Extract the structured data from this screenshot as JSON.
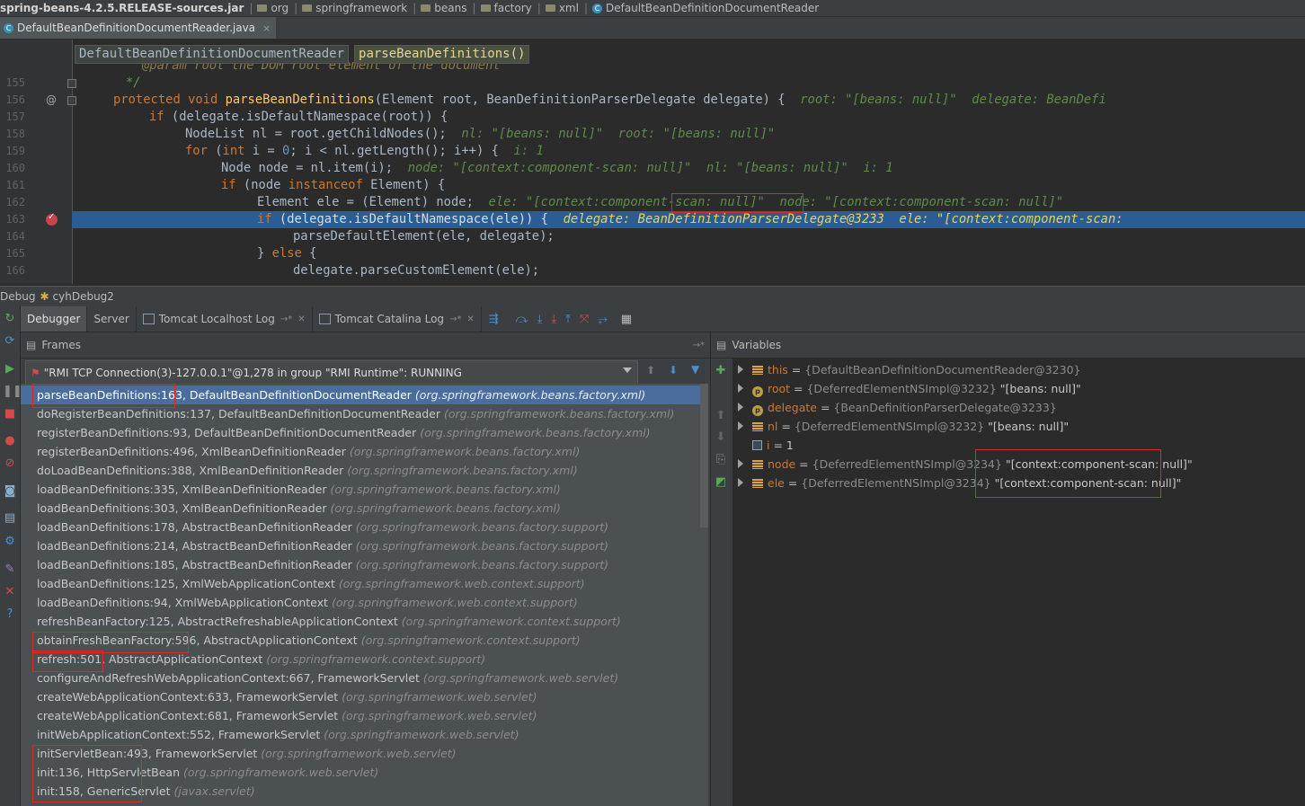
{
  "breadcrumb": [
    {
      "label": "spring-beans-4.2.5.RELEASE-sources.jar",
      "icon": "jar-icon"
    },
    {
      "label": "org",
      "icon": "folder-icon"
    },
    {
      "label": "springframework",
      "icon": "folder-icon"
    },
    {
      "label": "beans",
      "icon": "folder-icon"
    },
    {
      "label": "factory",
      "icon": "folder-icon"
    },
    {
      "label": "xml",
      "icon": "folder-icon"
    },
    {
      "label": "DefaultBeanDefinitionDocumentReader",
      "icon": "class-icon"
    }
  ],
  "file_tab": {
    "label": "DefaultBeanDefinitionDocumentReader.java",
    "close": "×"
  },
  "editor": {
    "header_class": "DefaultBeanDefinitionDocumentReader",
    "header_method": "parseBeanDefinitions()",
    "top_partial": "@param root the DOM root element of the document",
    "lines": [
      {
        "n": "155",
        "text": "*/"
      },
      {
        "n": "156",
        "pre": "protected void ",
        "method": "parseBeanDefinitions",
        "rest": "(Element root, BeanDefinitionParserDelegate delegate) {",
        "debug": "root: \"[beans: null]\"  delegate: BeanDefi"
      },
      {
        "n": "157",
        "kw": "if",
        "rest": " (delegate.isDefaultNamespace(root)) {"
      },
      {
        "n": "158",
        "rest": "NodeList nl = root.getChildNodes();",
        "debug": "nl: \"[beans: null]\"  root: \"[beans: null]\""
      },
      {
        "n": "159",
        "kw": "for",
        "rest1": " (",
        "kw2": "int",
        "rest2": " i = ",
        "num": "0",
        "rest3": "; i < nl.getLength(); i++) {",
        "debug": "i: 1"
      },
      {
        "n": "160",
        "rest": "Node node = nl.item(i);",
        "debug": "node: \"[context:component-scan: null]\"  nl: \"[beans: null]\"  i: 1"
      },
      {
        "n": "161",
        "kw": "if",
        "rest1": " (node ",
        "kw2": "instanceof",
        "rest2": " Element) {"
      },
      {
        "n": "162",
        "rest": "Element ele = (Element) node;",
        "debug": "ele: \"[context:component-scan: null]\"  node: \"[context:component-scan: null]\""
      },
      {
        "n": "163",
        "kw": "if",
        "rest": " (delegate.isDefaultNamespace(ele)) {",
        "debug": "delegate: BeanDefinitionParserDelegate@3233  ele: \"[context:component-scan:"
      },
      {
        "n": "164",
        "rest": "parseDefaultElement(ele, delegate);"
      },
      {
        "n": "165",
        "pre": "} ",
        "kw": "else",
        "rest": " {"
      },
      {
        "n": "166",
        "rest": "delegate.parseCustomElement(ele);"
      }
    ]
  },
  "debug": {
    "label": "Debug",
    "config": "cyhDebug2",
    "tabs": [
      {
        "label": "Debugger",
        "selected": true
      },
      {
        "label": "Server"
      },
      {
        "label": "Tomcat Localhost Log",
        "pin": "→*"
      },
      {
        "label": "Tomcat Catalina Log",
        "pin": "→*"
      }
    ],
    "frames_title": "Frames",
    "variables_title": "Variables",
    "thread": "\"RMI TCP Connection(3)-127.0.0.1\"@1,278 in group \"RMI Runtime\": RUNNING",
    "frames": [
      {
        "m": "parseBeanDefinitions:163,",
        "c": " DefaultBeanDefinitionDocumentReader ",
        "p": "(org.springframework.beans.factory.xml)"
      },
      {
        "m": "doRegisterBeanDefinitions:137,",
        "c": " DefaultBeanDefinitionDocumentReader ",
        "p": "(org.springframework.beans.factory.xml)"
      },
      {
        "m": "registerBeanDefinitions:93,",
        "c": " DefaultBeanDefinitionDocumentReader ",
        "p": "(org.springframework.beans.factory.xml)"
      },
      {
        "m": "registerBeanDefinitions:496,",
        "c": " XmlBeanDefinitionReader ",
        "p": "(org.springframework.beans.factory.xml)"
      },
      {
        "m": "doLoadBeanDefinitions:388,",
        "c": " XmlBeanDefinitionReader ",
        "p": "(org.springframework.beans.factory.xml)"
      },
      {
        "m": "loadBeanDefinitions:335,",
        "c": " XmlBeanDefinitionReader ",
        "p": "(org.springframework.beans.factory.xml)"
      },
      {
        "m": "loadBeanDefinitions:303,",
        "c": " XmlBeanDefinitionReader ",
        "p": "(org.springframework.beans.factory.xml)"
      },
      {
        "m": "loadBeanDefinitions:178,",
        "c": " AbstractBeanDefinitionReader ",
        "p": "(org.springframework.beans.factory.support)"
      },
      {
        "m": "loadBeanDefinitions:214,",
        "c": " AbstractBeanDefinitionReader ",
        "p": "(org.springframework.beans.factory.support)"
      },
      {
        "m": "loadBeanDefinitions:185,",
        "c": " AbstractBeanDefinitionReader ",
        "p": "(org.springframework.beans.factory.support)"
      },
      {
        "m": "loadBeanDefinitions:125,",
        "c": " XmlWebApplicationContext ",
        "p": "(org.springframework.web.context.support)"
      },
      {
        "m": "loadBeanDefinitions:94,",
        "c": " XmlWebApplicationContext ",
        "p": "(org.springframework.web.context.support)"
      },
      {
        "m": "refreshBeanFactory:125,",
        "c": " AbstractRefreshableApplicationContext ",
        "p": "(org.springframework.context.support)"
      },
      {
        "m": "obtainFreshBeanFactory:596,",
        "c": " AbstractApplicationContext ",
        "p": "(org.springframework.context.support)"
      },
      {
        "m": "refresh:501,",
        "c": " AbstractApplicationContext ",
        "p": "(org.springframework.context.support)"
      },
      {
        "m": "configureAndRefreshWebApplicationContext:667,",
        "c": " FrameworkServlet ",
        "p": "(org.springframework.web.servlet)"
      },
      {
        "m": "createWebApplicationContext:633,",
        "c": " FrameworkServlet ",
        "p": "(org.springframework.web.servlet)"
      },
      {
        "m": "createWebApplicationContext:681,",
        "c": " FrameworkServlet ",
        "p": "(org.springframework.web.servlet)"
      },
      {
        "m": "initWebApplicationContext:552,",
        "c": " FrameworkServlet ",
        "p": "(org.springframework.web.servlet)"
      },
      {
        "m": "initServletBean:493,",
        "c": " FrameworkServlet ",
        "p": "(org.springframework.web.servlet)"
      },
      {
        "m": "init:136,",
        "c": " HttpServletBean ",
        "p": "(org.springframework.web.servlet)"
      },
      {
        "m": "init:158,",
        "c": " GenericServlet ",
        "p": "(javax.servlet)"
      }
    ],
    "variables": [
      {
        "name": "this",
        "type": "{DefaultBeanDefinitionDocumentReader@3230}",
        "val": "",
        "icon": "field",
        "expand": true
      },
      {
        "name": "root",
        "type": "{DeferredElementNSImpl@3232}",
        "val": " \"[beans: null]\"",
        "icon": "param",
        "expand": true
      },
      {
        "name": "delegate",
        "type": "{BeanDefinitionParserDelegate@3233}",
        "val": "",
        "icon": "param",
        "expand": true
      },
      {
        "name": "nl",
        "type": "{DeferredElementNSImpl@3232}",
        "val": " \"[beans: null]\"",
        "icon": "field",
        "expand": true
      },
      {
        "name": "i",
        "type": "",
        "val": "1",
        "icon": "int",
        "expand": false
      },
      {
        "name": "node",
        "type": "{DeferredElementNSImpl@3234}",
        "val": " \"[context:component-scan: null]\"",
        "icon": "field",
        "expand": true
      },
      {
        "name": "ele",
        "type": "{DeferredElementNSImpl@3234}",
        "val": " \"[context:component-scan: null]\"",
        "icon": "field",
        "expand": true
      }
    ]
  }
}
